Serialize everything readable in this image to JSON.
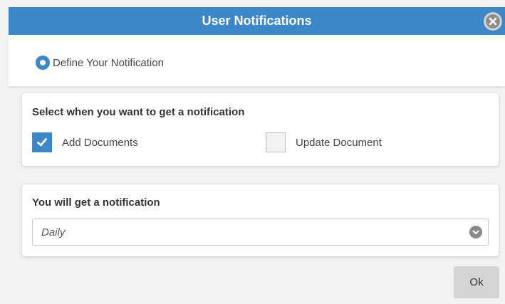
{
  "dialog": {
    "title": "User Notifications",
    "close_icon": "close-circle-icon"
  },
  "step": {
    "label": "Define Your Notification",
    "icon": "radio-selected-icon"
  },
  "when_section": {
    "title": "Select when you want to get a notification",
    "options": [
      {
        "label": "Add Documents",
        "checked": true
      },
      {
        "label": "Update Document",
        "checked": false
      }
    ]
  },
  "frequency_section": {
    "title": "You will get a notification",
    "selected": "Daily",
    "dropdown_icon": "chevron-down-icon"
  },
  "ok_label": "Ok",
  "colors": {
    "accent": "#3d87c9",
    "background": "#f2f2f2",
    "button": "#d4d4d4"
  }
}
